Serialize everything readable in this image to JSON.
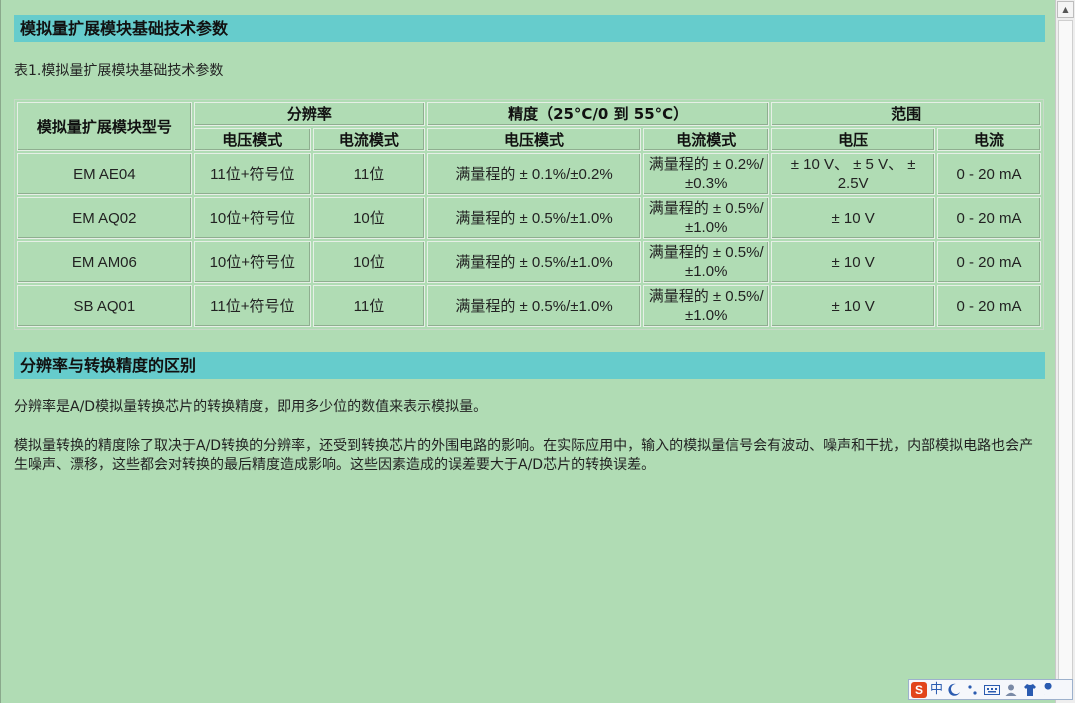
{
  "section1": {
    "title": "模拟量扩展模块基础技术参数"
  },
  "table_caption": "表1.模拟量扩展模块基础技术参数",
  "table": {
    "header": {
      "model": "模拟量扩展模块型号",
      "resolution": "分辨率",
      "accuracy": "精度（25°C/0 到  55°C）",
      "range": "范围",
      "voltage_mode": "电压模式",
      "current_mode": "电流模式",
      "voltage": "电压",
      "current": "电流"
    },
    "rows": [
      {
        "model": "EM AE04",
        "res_v": "11位+符号位",
        "res_i": "11位",
        "acc_v": "满量程的  ± 0.1%/±0.2%",
        "acc_i": "满量程的  ± 0.2%/±0.3%",
        "range_v": "± 10 V、 ± 5 V、 ± 2.5V",
        "range_i": "0 - 20 mA"
      },
      {
        "model": "EM AQ02",
        "res_v": "10位+符号位",
        "res_i": "10位",
        "acc_v": "满量程的  ± 0.5%/±1.0%",
        "acc_i": "满量程的  ± 0.5%/±1.0%",
        "range_v": "± 10 V",
        "range_i": "0 - 20 mA"
      },
      {
        "model": "EM AM06",
        "res_v": "10位+符号位",
        "res_i": "10位",
        "acc_v": "满量程的  ± 0.5%/±1.0%",
        "acc_i": "满量程的  ± 0.5%/±1.0%",
        "range_v": "± 10 V",
        "range_i": "0 - 20 mA"
      },
      {
        "model": "SB AQ01",
        "res_v": "11位+符号位",
        "res_i": "11位",
        "acc_v": "满量程的  ± 0.5%/±1.0%",
        "acc_i": "满量程的  ± 0.5%/±1.0%",
        "range_v": "± 10 V",
        "range_i": "0 - 20 mA"
      }
    ]
  },
  "section2": {
    "title": "分辨率与转换精度的区别",
    "para1": "分辨率是A/D模拟量转换芯片的转换精度，即用多少位的数值来表示模拟量。",
    "para2": "模拟量转换的精度除了取决于A/D转换的分辨率，还受到转换芯片的外围电路的影响。在实际应用中，输入的模拟量信号会有波动、噪声和干扰，内部模拟电路也会产生噪声、漂移，这些都会对转换的最后精度造成影响。这些因素造成的误差要大于A/D芯片的转换误差。"
  },
  "ime_toolbar": {
    "logo": "S",
    "mode": "中",
    "icons": [
      "moon-icon",
      "punctuation-icon",
      "keyboard-icon",
      "user-icon",
      "shirt-icon",
      "wrench-icon"
    ]
  },
  "colors": {
    "page_bg": "#b0dcb4",
    "section_bar": "#66cccc",
    "ime_logo": "#e2451b"
  }
}
